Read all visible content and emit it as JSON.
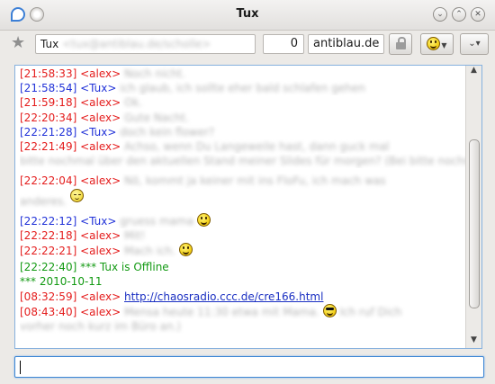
{
  "window": {
    "title": "Tux"
  },
  "titlebar": {
    "icons": [
      "chat-bubble-icon",
      "sticky-pin-icon"
    ],
    "buttons": [
      "minimize-icon",
      "maximize-icon",
      "close-icon"
    ]
  },
  "toolbar": {
    "contact_name": "Tux",
    "contact_jid_blurred": "<tux@antiblau.de/scholle>",
    "count": "0",
    "host": "antiblau.de",
    "icons": [
      "star-icon",
      "lock-icon",
      "smiley-icon",
      "chevron-down-icon"
    ]
  },
  "colors": {
    "self": "#e41c1c",
    "contact": "#2132d8",
    "status": "#139a13",
    "link": "#1a2fc2",
    "accent": "#3d86d4"
  },
  "messages": [
    {
      "time": "[21:58:33]",
      "nick": "<alex>",
      "text": "Noch nicht."
    },
    {
      "time": "[21:58:54]",
      "nick": "<Tux>",
      "text": "ich glaub, ich sollte eher bald schlafen gehen"
    },
    {
      "time": "[21:59:18]",
      "nick": "<alex>",
      "text": "Ok."
    },
    {
      "time": "[22:20:34]",
      "nick": "<alex>",
      "text": "Gute Nacht."
    },
    {
      "time": "[22:21:28]",
      "nick": "<Tux>",
      "text": "doch kein flower?"
    },
    {
      "time": "[22:21:49]",
      "nick": "<alex>",
      "text": "Achso, wenn Du Langeweile hast, dann guck mal",
      "cont": "bitte nochmal über den aktuellen Stand meiner Slides für morgen? (Bei bitte nochmal!)"
    },
    {
      "time": "[22:22:04]",
      "nick": "<alex>",
      "text": "Nö, kommt ja keiner mit ins FloFu, ich mach was",
      "cont": "anderes."
    },
    {
      "time": "[22:22:12]",
      "nick": "<Tux>",
      "text": "gruess mama"
    },
    {
      "time": "[22:22:18]",
      "nick": "<alex>",
      "text": "Mit!"
    },
    {
      "time": "[22:22:21]",
      "nick": "<alex>",
      "text": "Mach ich."
    },
    {
      "status": "[22:22:40] *** Tux is Offline"
    },
    {
      "status": "*** 2010-10-11"
    },
    {
      "time": "[08:32:59]",
      "nick": "<alex>",
      "link": "http://chaosradio.ccc.de/cre166.html"
    },
    {
      "time": "[08:43:40]",
      "nick": "<alex>",
      "text": "Mensa heute 11:30 etwa mit Mama.",
      "after": "Ich ruf Dich",
      "cont": "vorher noch kurz im Büro an.)"
    }
  ],
  "input": {
    "value": ""
  }
}
